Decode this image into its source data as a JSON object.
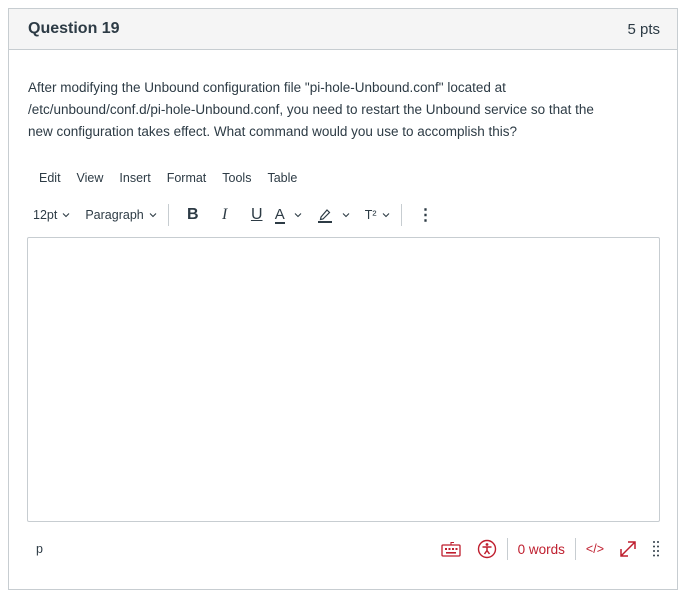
{
  "question": {
    "title": "Question 19",
    "points": "5 pts",
    "text_line1": "After modifying the Unbound configuration file \"pi-hole-Unbound.conf\" located at",
    "text_line2": "/etc/unbound/conf.d/pi-hole-Unbound.conf, you need to restart the Unbound service so that the",
    "text_line3": "new configuration takes effect.  What command would you use to accomplish this?"
  },
  "editor": {
    "menu": [
      "Edit",
      "View",
      "Insert",
      "Format",
      "Tools",
      "Table"
    ],
    "toolbar": {
      "font_size": "12pt",
      "block_format": "Paragraph",
      "bold": "B",
      "italic": "I",
      "underline": "U",
      "text_color": "A",
      "superscript": "T²",
      "more": "⋮"
    },
    "content": "",
    "status": {
      "path": "p",
      "word_count": "0 words",
      "html_toggle": "</>"
    },
    "colors": {
      "accent": "#bf1e2e",
      "text": "#2d3b45",
      "border": "#c7cdd1",
      "header_bg": "#f5f5f5"
    },
    "icons": [
      "keyboard-icon",
      "accessibility-icon",
      "fullscreen-icon",
      "resize-handle-icon",
      "chevron-down-icon",
      "highlight-icon"
    ]
  }
}
